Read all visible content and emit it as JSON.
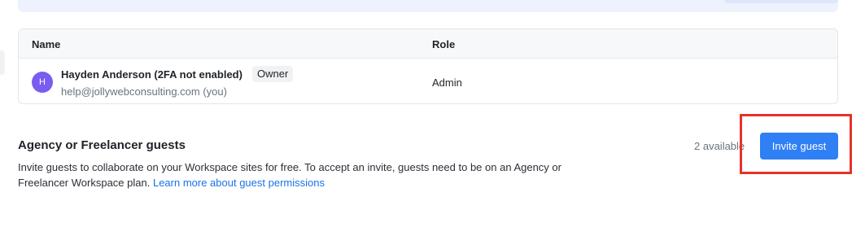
{
  "table": {
    "headers": {
      "name": "Name",
      "role": "Role"
    },
    "rows": [
      {
        "avatar_initial": "H",
        "name": "Hayden Anderson (2FA not enabled)",
        "badge": "Owner",
        "email": "help@jollywebconsulting.com (you)",
        "role": "Admin"
      }
    ]
  },
  "guests": {
    "title": "Agency or Freelancer guests",
    "description": "Invite guests to collaborate on your Workspace sites for free. To accept an invite, guests need to be on an Agency or Freelancer Workspace plan.",
    "link_text": "Learn more about guest permissions",
    "available": "2 available",
    "invite_button": "Invite guest"
  },
  "colors": {
    "accent": "#2f7ff5",
    "avatar": "#7b5cf0",
    "highlight": "#e5332a",
    "link": "#1a73e8"
  }
}
